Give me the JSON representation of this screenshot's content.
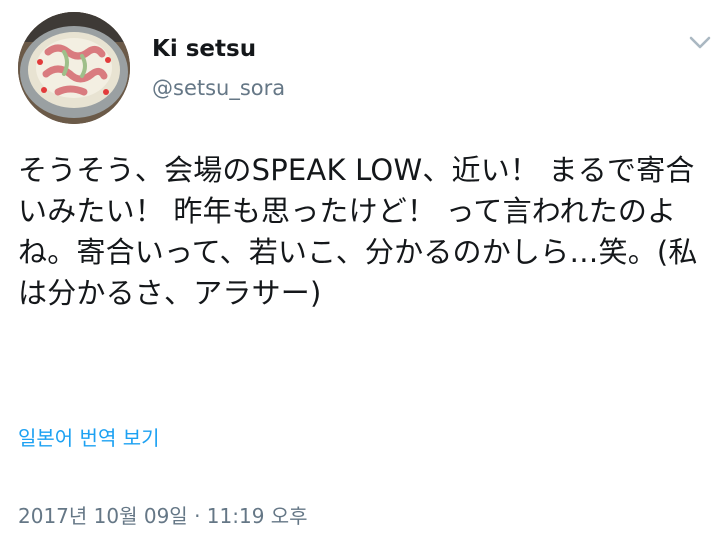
{
  "user": {
    "display_name": "Ki setsu",
    "handle": "@setsu_sora"
  },
  "tweet": {
    "text": "そうそう、会場のSPEAK LOW、近い！ まるで寄合いみたい！ 昨年も思ったけど！ って言われたのよね。寄合いって、若いこ、分かるのかしら…笑。(私は分かるさ、アラサー)",
    "translate_label": "일본어 번역 보기",
    "timestamp": "2017년 10월 09일 · 11:19 오후"
  },
  "icons": {
    "menu": "chevron-down-icon",
    "avatar": "profile-avatar"
  },
  "colors": {
    "link": "#1da1f2",
    "secondary": "#657786",
    "text": "#14171a"
  }
}
